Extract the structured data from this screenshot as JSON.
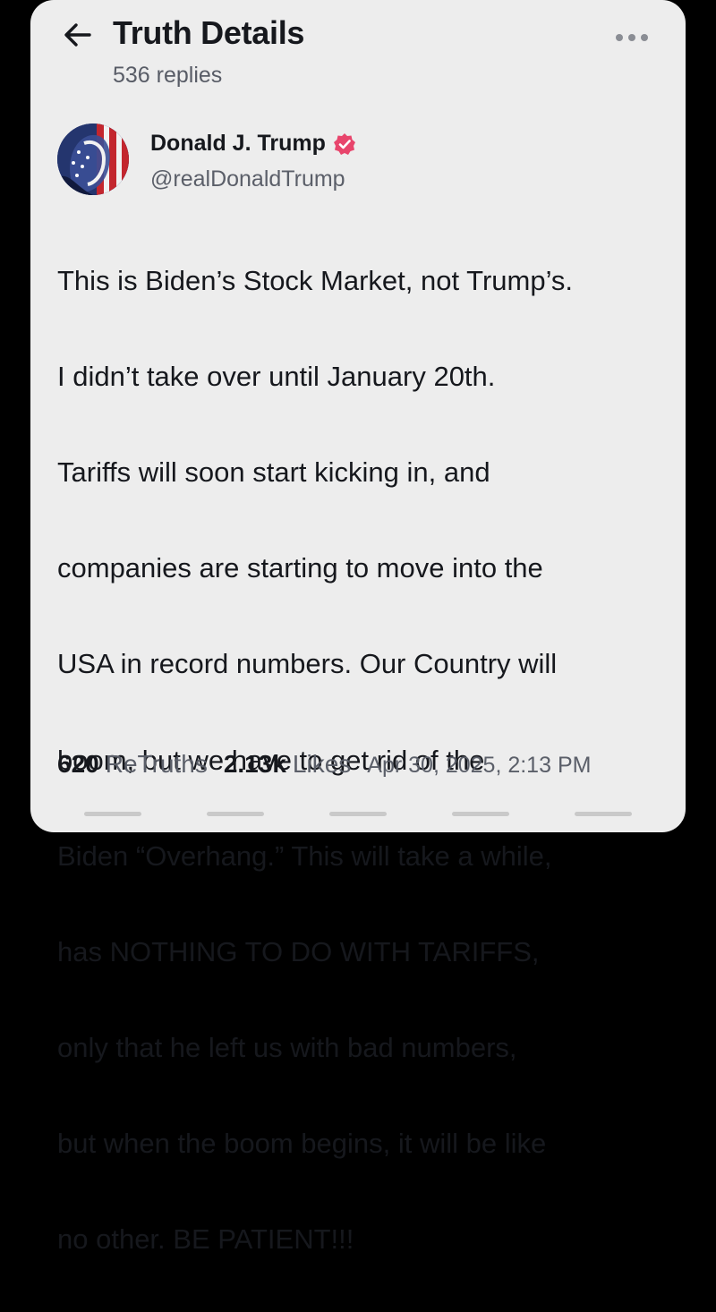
{
  "header": {
    "title": "Truth Details",
    "replies": "536 replies",
    "back_icon": "arrow-left-icon",
    "more_icon": "more-horizontal-icon"
  },
  "author": {
    "name": "Donald J. Trump",
    "handle": "@realDonaldTrump",
    "verified": true,
    "verified_color": "#e8456c"
  },
  "post": {
    "text": "This is Biden’s Stock Market, not Trump’s. I didn’t take over until January 20th. Tariffs will soon start kicking in, and companies are starting to move into the USA in record numbers. Our Country will boom, but we have to get rid of the Biden “Overhang.” This will take a while, has NOTHING TO DO WITH TARIFFS, only that he left us with bad numbers, but when the boom begins, it will be like no other. BE PATIENT!!!",
    "lines": [
      "This is Biden’s Stock Market, not Trump’s.",
      "I didn’t take over until January 20th.",
      "Tariffs will soon start kicking in, and",
      "companies are starting to move into the",
      "USA in record numbers. Our Country will",
      "boom, but we have to get rid of the",
      "Biden “Overhang.” This will take a while,",
      "has NOTHING TO DO WITH TARIFFS,",
      "only that he left us with bad numbers,",
      "but when the boom begins, it will be like",
      "no other. BE PATIENT!!!"
    ]
  },
  "stats": {
    "retruths_count": "620",
    "retruths_label": "ReTruths",
    "likes_count": "2.13k",
    "likes_label": "Likes",
    "timestamp": "Apr 30, 2025, 2:13 PM"
  },
  "colors": {
    "page_background": "#000000",
    "card_background": "#ededed",
    "text_primary": "#16181d",
    "text_secondary": "#5b5f69"
  }
}
